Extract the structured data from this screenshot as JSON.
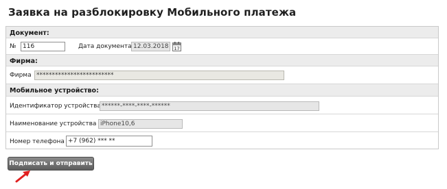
{
  "page": {
    "title": "Заявка на разблокировку Мобильного платежа"
  },
  "document": {
    "section_label": "Документ:",
    "number_label": "№",
    "number_value": "116",
    "date_label": "Дата документа",
    "date_value": "12.03.2018",
    "calendar_icon": "calendar-icon",
    "calendar_day": "17"
  },
  "company": {
    "section_label": "Фирма:",
    "name_label": "Фирма",
    "name_value": "*************************"
  },
  "device": {
    "section_label": "Мобильное устройство:",
    "id_label": "Идентификатор устройства",
    "id_value": "******-****-****-******",
    "name_label": "Наименование устройства",
    "name_value": "iPhone10,6",
    "phone_label": "Номер телефона",
    "phone_value": "+7 (962) *** **"
  },
  "actions": {
    "submit_label": "Подписать и отправить",
    "pointer_icon": "red-arrow-icon",
    "accent_color": "#e02020"
  }
}
